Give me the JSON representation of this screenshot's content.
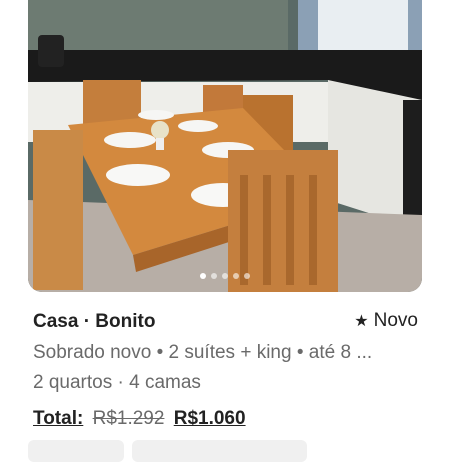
{
  "listing": {
    "title": "Casa · Bonito",
    "badge": "Novo",
    "description": "Sobrado novo • 2 suítes + king • até 8 ...",
    "rooms": "2 quartos · 4 camas",
    "total_label": "Total:",
    "old_price": "R$1.292",
    "new_price": "R$1.060"
  },
  "gallery": {
    "image_count": 5,
    "active_index": 0
  },
  "colors": {
    "text": "#222222",
    "muted": "#6a6a6a"
  },
  "icons": {
    "badge": "star-icon"
  }
}
